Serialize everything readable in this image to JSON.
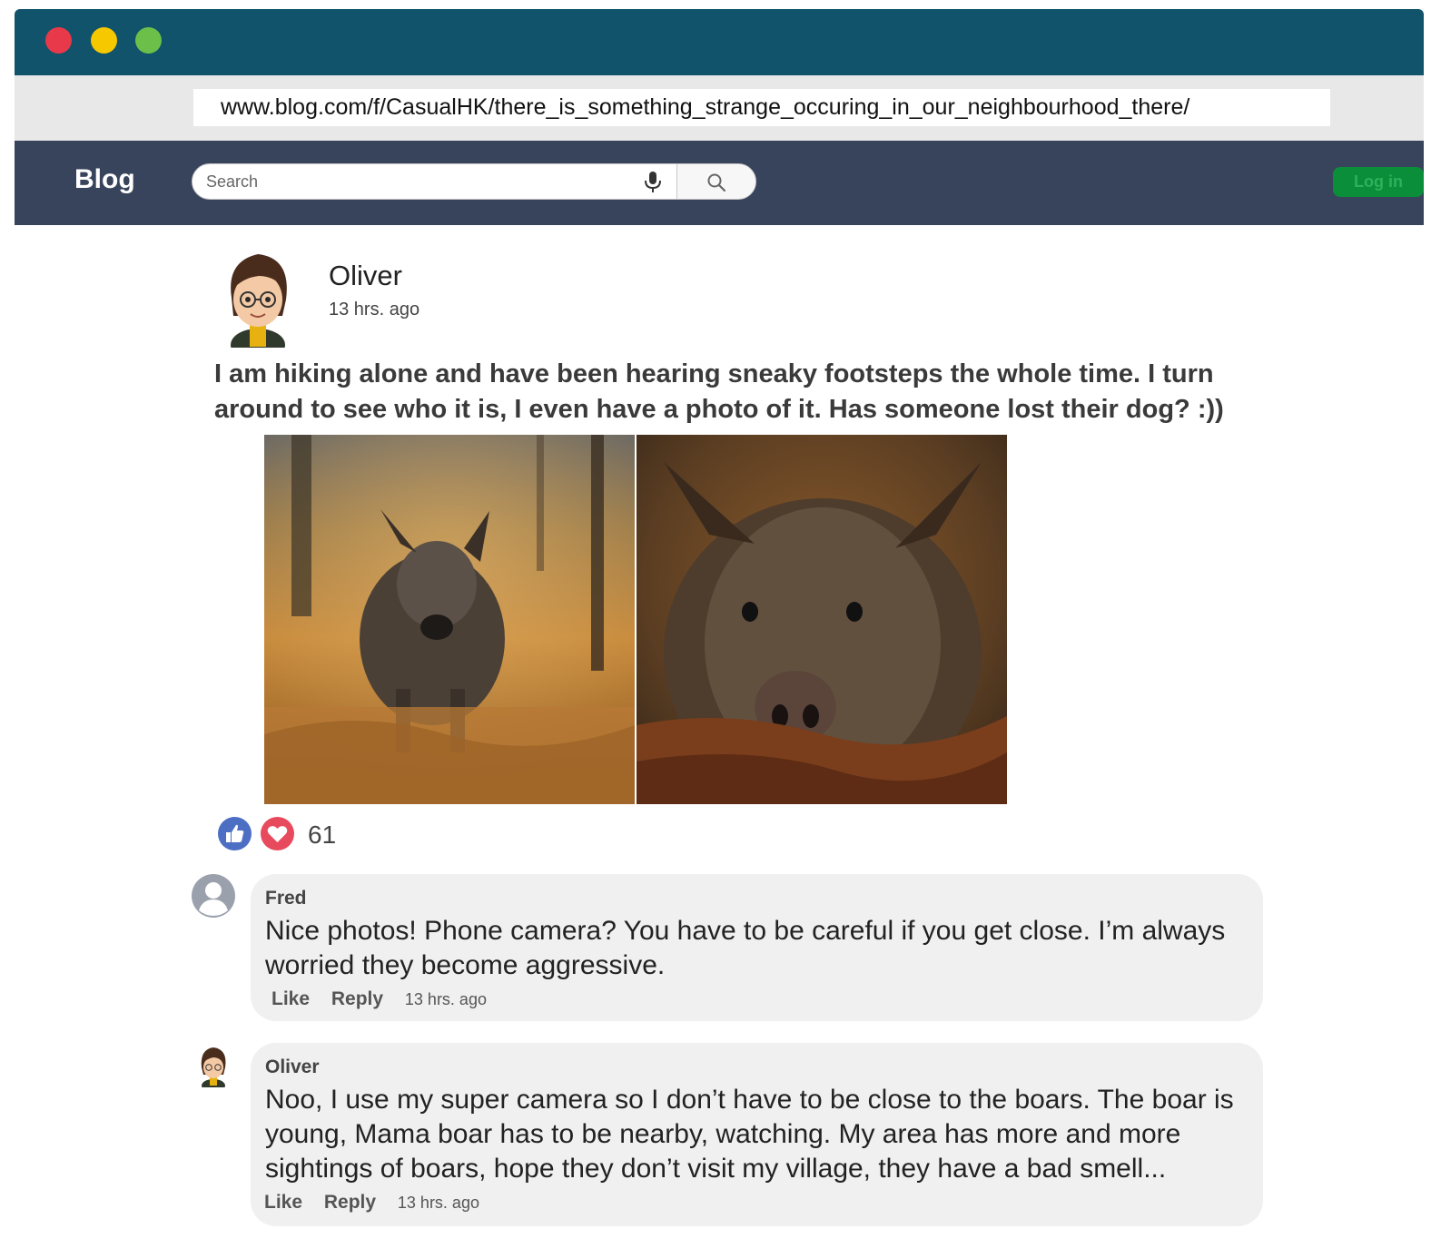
{
  "browser": {
    "url": "www.blog.com/f/CasualHK/there_is_something_strange_occuring_in_our_neighbourhood_there/"
  },
  "nav": {
    "brand": "Blog",
    "search_placeholder": "Search",
    "login_label": "Log in"
  },
  "post": {
    "author": "Oliver",
    "time": "13 hrs. ago",
    "text": "I am hiking alone and have been hearing sneaky footsteps the whole time. I turn around to see who it is,  I even have a photo of it. Has someone lost their dog? :))",
    "reaction_count": "61"
  },
  "comments": [
    {
      "author": "Fred",
      "text": "Nice photos! Phone camera? You have to be careful if you get close. I’m always worried they become aggressive.",
      "like_label": "Like",
      "reply_label": "Reply",
      "time": "13 hrs. ago"
    },
    {
      "author": "Oliver",
      "text": "Noo, I use my super camera so I don’t have to be close to the boars. The boar is young, Mama boar has to be nearby, watching. My area has more and more sightings of boars, hope they don’t visit my village, they have a bad smell...",
      "like_label": "Like",
      "reply_label": "Reply",
      "time": "13 hrs. ago"
    }
  ],
  "colors": {
    "titlebar": "#11536a",
    "navbar": "#38435c",
    "login": "#0b8e3a",
    "like": "#4c6fc4",
    "love": "#e84a5d"
  }
}
